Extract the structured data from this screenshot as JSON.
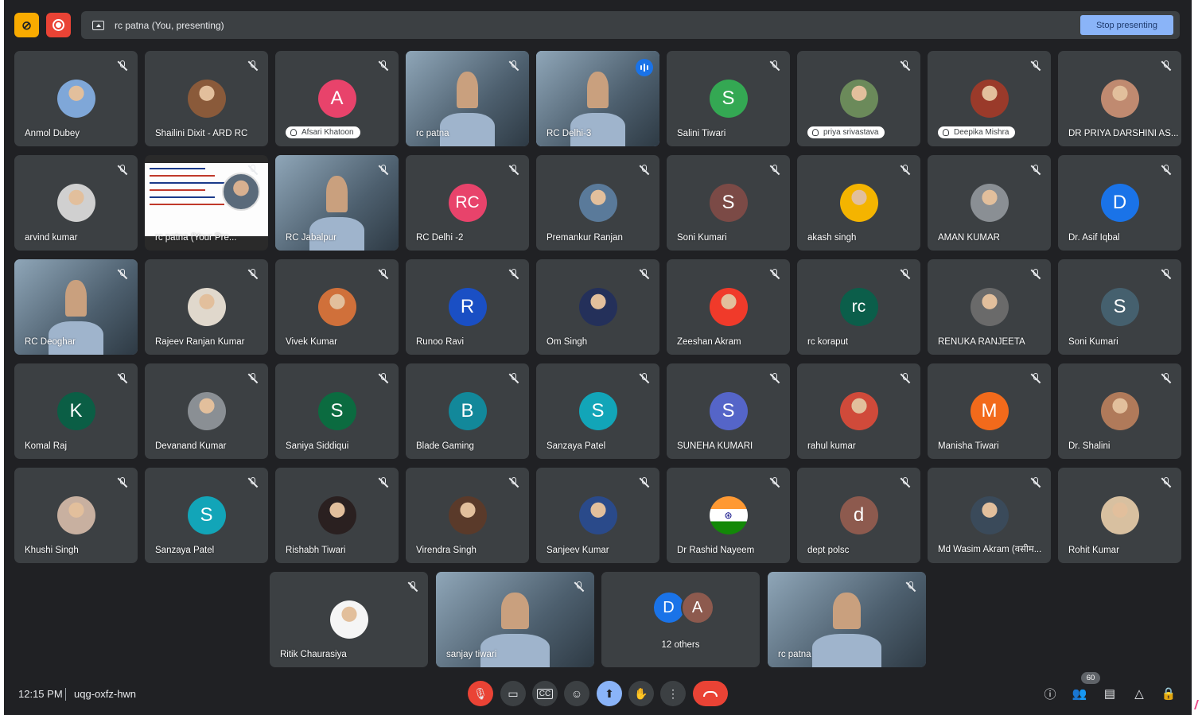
{
  "topbar": {
    "presenter_label": "rc patna (You, presenting)",
    "stop_label": "Stop presenting"
  },
  "tiles": [
    {
      "name": "Anmol Dubey",
      "type": "avatar-photo",
      "color": "#7fa7d8"
    },
    {
      "name": "Shailini Dixit - ARD RC",
      "type": "avatar-photo",
      "color": "#8a5a3a"
    },
    {
      "name": "Afsari Khatoon",
      "type": "letter",
      "letter": "A",
      "color": "#e8436b",
      "pill": true
    },
    {
      "name": "rc patna",
      "type": "video"
    },
    {
      "name": "RC Delhi-3",
      "type": "video",
      "speaking": true
    },
    {
      "name": "Salini Tiwari",
      "type": "letter",
      "letter": "S",
      "color": "#34a853"
    },
    {
      "name": "priya srivastava",
      "type": "avatar-photo",
      "color": "#6b8a5a",
      "pill": true
    },
    {
      "name": "Deepika Mishra",
      "type": "avatar-photo",
      "color": "#9a3a2a",
      "pill": true
    },
    {
      "name": "DR PRIYA DARSHINI AS...",
      "type": "avatar-photo",
      "color": "#c08a70"
    },
    {
      "name": "arvind kumar",
      "type": "avatar-photo",
      "color": "#d0d0d0"
    },
    {
      "name": "rc patna (Your Pre...",
      "type": "video-slide"
    },
    {
      "name": "RC Jabalpur",
      "type": "video"
    },
    {
      "name": "RC Delhi -2",
      "type": "letter",
      "letter": "RC",
      "color": "#e8436b"
    },
    {
      "name": "Premankur Ranjan",
      "type": "avatar-photo",
      "color": "#5a7a9a"
    },
    {
      "name": "Soni Kumari",
      "type": "letter",
      "letter": "S",
      "color": "#7b4a46"
    },
    {
      "name": "akash singh",
      "type": "avatar-photo",
      "color": "#f4b400"
    },
    {
      "name": "AMAN KUMAR",
      "type": "avatar-photo",
      "color": "#8a8f94"
    },
    {
      "name": "Dr. Asif Iqbal",
      "type": "letter",
      "letter": "D",
      "color": "#1a73e8"
    },
    {
      "name": "RC Deoghar",
      "type": "video"
    },
    {
      "name": "Rajeev Ranjan Kumar",
      "type": "avatar-photo",
      "color": "#e0d8cc"
    },
    {
      "name": "Vivek Kumar",
      "type": "avatar-photo",
      "color": "#d0703a"
    },
    {
      "name": "Runoo Ravi",
      "type": "letter",
      "letter": "R",
      "color": "#1a4fc4"
    },
    {
      "name": "Om Singh",
      "type": "avatar-photo",
      "color": "#24305a"
    },
    {
      "name": "Zeeshan Akram",
      "type": "avatar-photo",
      "color": "#f03a2a"
    },
    {
      "name": "rc koraput",
      "type": "letter",
      "letter": "rc",
      "color": "#0b5e4a"
    },
    {
      "name": "RENUKA RANJEETA",
      "type": "avatar-photo",
      "color": "#6a6a6a"
    },
    {
      "name": "Soni Kumari",
      "type": "letter",
      "letter": "S",
      "color": "#45606e"
    },
    {
      "name": "Komal Raj",
      "type": "letter",
      "letter": "K",
      "color": "#0b5e45"
    },
    {
      "name": "Devanand Kumar",
      "type": "avatar-photo",
      "color": "#8a8f94"
    },
    {
      "name": "Saniya Siddiqui",
      "type": "letter",
      "letter": "S",
      "color": "#0b6b40"
    },
    {
      "name": "Blade Gaming",
      "type": "letter",
      "letter": "B",
      "color": "#12889a"
    },
    {
      "name": "Sanzaya Patel",
      "type": "letter",
      "letter": "S",
      "color": "#12a5b8"
    },
    {
      "name": "SUNEHA KUMARI",
      "type": "letter",
      "letter": "S",
      "color": "#5565c8"
    },
    {
      "name": "rahul kumar",
      "type": "avatar-photo",
      "color": "#d04a3a"
    },
    {
      "name": "Manisha Tiwari",
      "type": "letter",
      "letter": "M",
      "color": "#f26a1b"
    },
    {
      "name": "Dr. Shalini",
      "type": "avatar-photo",
      "color": "#b07a5a"
    },
    {
      "name": "Khushi Singh",
      "type": "avatar-photo",
      "color": "#c8b0a0"
    },
    {
      "name": "Sanzaya Patel",
      "type": "letter",
      "letter": "S",
      "color": "#12a5b8"
    },
    {
      "name": "Rishabh Tiwari",
      "type": "avatar-photo",
      "color": "#2a2020"
    },
    {
      "name": "Virendra Singh",
      "type": "avatar-photo",
      "color": "#5a3a2a"
    },
    {
      "name": "Sanjeev Kumar",
      "type": "avatar-photo",
      "color": "#2a4a8a"
    },
    {
      "name": "Dr Rashid Nayeem",
      "type": "avatar-flag",
      "color": "#ff9933"
    },
    {
      "name": "dept polsc",
      "type": "letter",
      "letter": "d",
      "color": "#8d5a4e"
    },
    {
      "name": "Md Wasim Akram (वसीम...",
      "type": "avatar-photo",
      "color": "#3a4a5a"
    },
    {
      "name": "Rohit Kumar",
      "type": "avatar-photo",
      "color": "#d8c0a0"
    }
  ],
  "bottom_tiles": [
    {
      "name": "Ritik Chaurasiya",
      "type": "avatar-photo",
      "color": "#f5f5f5"
    },
    {
      "name": "sanjay tiwari",
      "type": "video"
    },
    {
      "name": "12 others",
      "type": "group",
      "letters": [
        "D",
        "A"
      ],
      "colors": [
        "#1a73e8",
        "#8d5a4e"
      ]
    },
    {
      "name": "rc patna",
      "type": "video"
    }
  ],
  "bottombar": {
    "time": "12:15 PM",
    "meeting_code": "uqg-oxfz-hwn",
    "participant_count": "60"
  }
}
